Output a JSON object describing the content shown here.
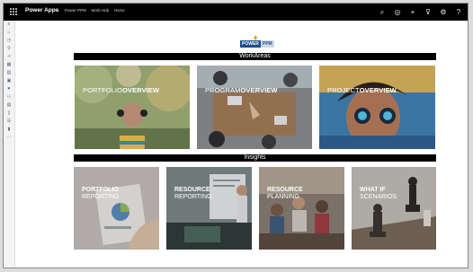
{
  "topbar": {
    "app_name": "Power Apps",
    "breadcrumbs": [
      "Power PPM",
      "Work Hub",
      "Home"
    ],
    "icons": [
      "search-icon",
      "target-icon",
      "add-icon",
      "filter-icon",
      "settings-icon",
      "help-icon"
    ]
  },
  "logo": {
    "part_a": "POWER",
    "part_b": "PPM"
  },
  "workareas": {
    "heading": "WorkAreas",
    "tiles": [
      {
        "prefix": "PORTFOLIO",
        "suffix": "OVERVIEW"
      },
      {
        "prefix": "PROGRAM",
        "suffix": "OVERVIEW"
      },
      {
        "prefix": "PROJECT",
        "suffix": "OVERVIEW"
      }
    ]
  },
  "insights": {
    "heading": "Insights",
    "tiles": [
      {
        "line1": "PORTFOLIO",
        "line2": "REPORTING"
      },
      {
        "line1": "RESOURCE",
        "line2": "REPORTING"
      },
      {
        "line1": "RESOURCE",
        "line2": "PLANNING"
      },
      {
        "line1": "WHAT IF",
        "line2": "SCENARIOS"
      }
    ]
  },
  "colors": {
    "topbar": "#000000",
    "accent": "#1a6bbd"
  }
}
